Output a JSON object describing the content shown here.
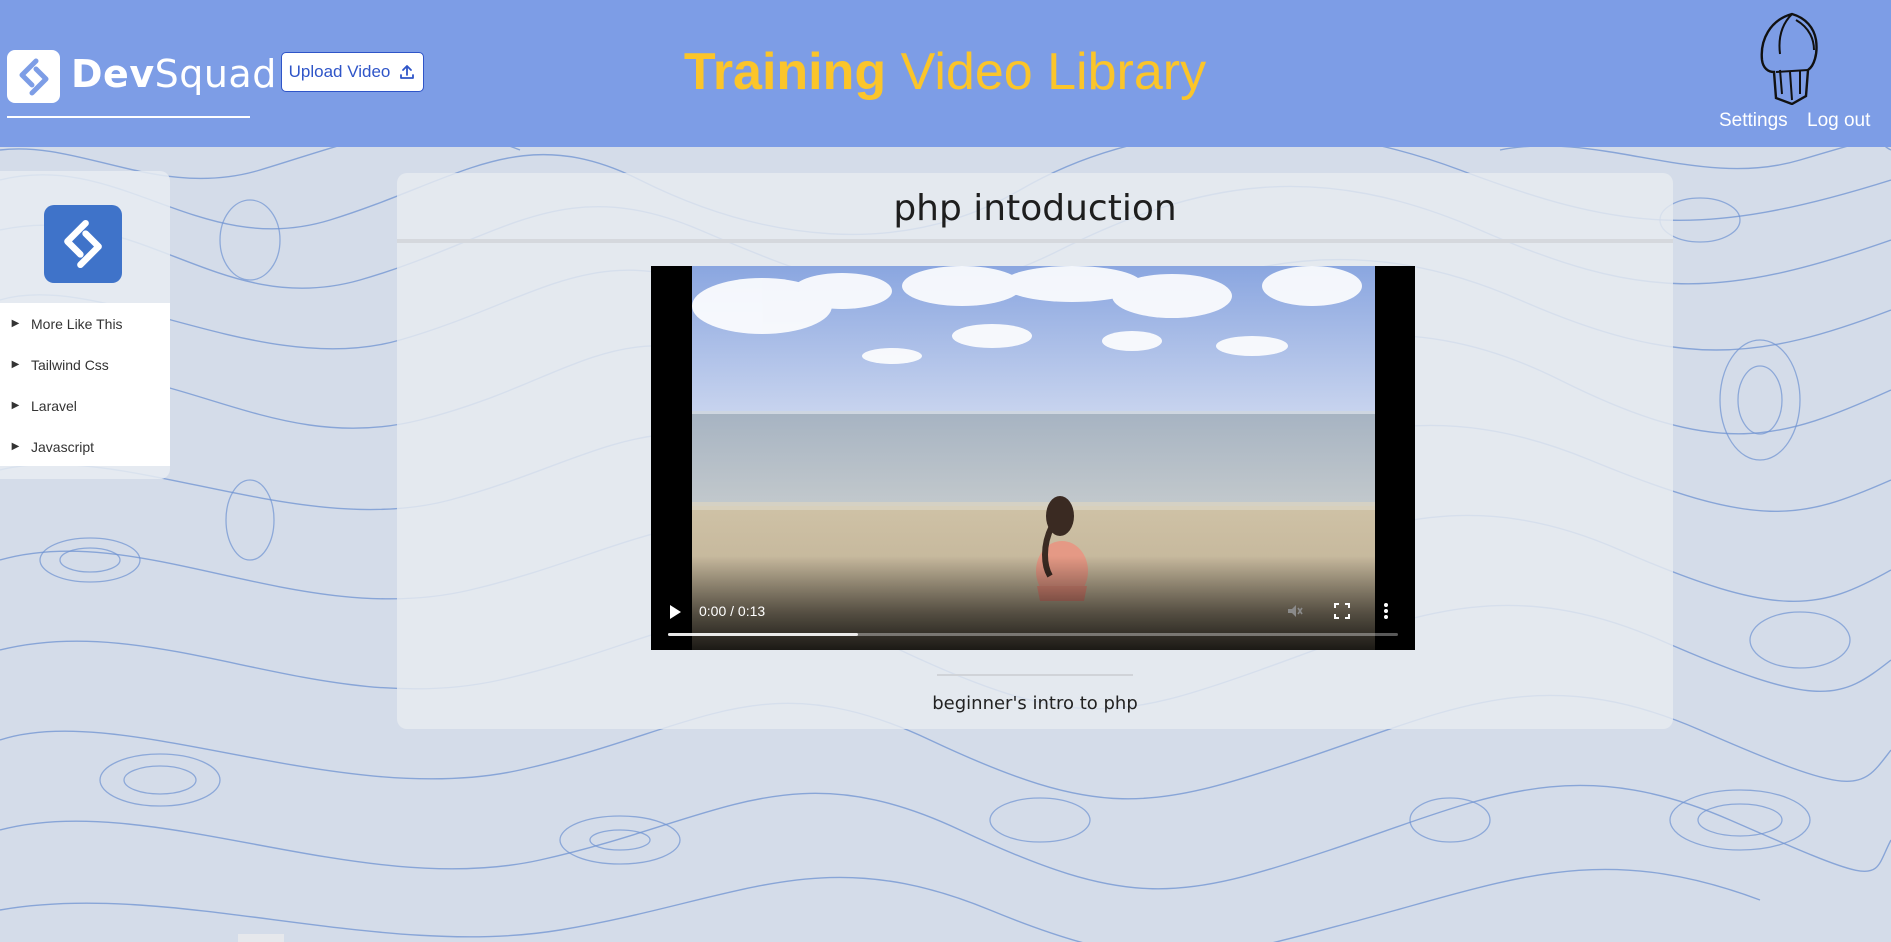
{
  "brand": {
    "name_part1": "Dev",
    "name_part2": "Squad"
  },
  "header": {
    "upload_label": "Upload Video",
    "title_strong": "Training",
    "title_rest": "Video Library",
    "settings_label": "Settings",
    "logout_label": "Log out"
  },
  "sidebar": {
    "items": [
      {
        "label": "More Like This"
      },
      {
        "label": "Tailwind Css"
      },
      {
        "label": "Laravel"
      },
      {
        "label": "Javascript"
      }
    ]
  },
  "main": {
    "title": "php intoduction",
    "caption": "beginner's intro to php"
  },
  "video": {
    "time": "0:00 / 0:13",
    "progress": 0.26
  },
  "colors": {
    "header_bg": "#7d9de6",
    "title_yellow": "#fbc52a",
    "brand_blue": "#3f73c9",
    "upload_blue": "#2f55c8"
  },
  "icons": [
    "devsquad-logo-icon",
    "upload-icon",
    "helmet-icon",
    "play-icon",
    "mute-icon",
    "fullscreen-icon",
    "more-options-icon"
  ]
}
